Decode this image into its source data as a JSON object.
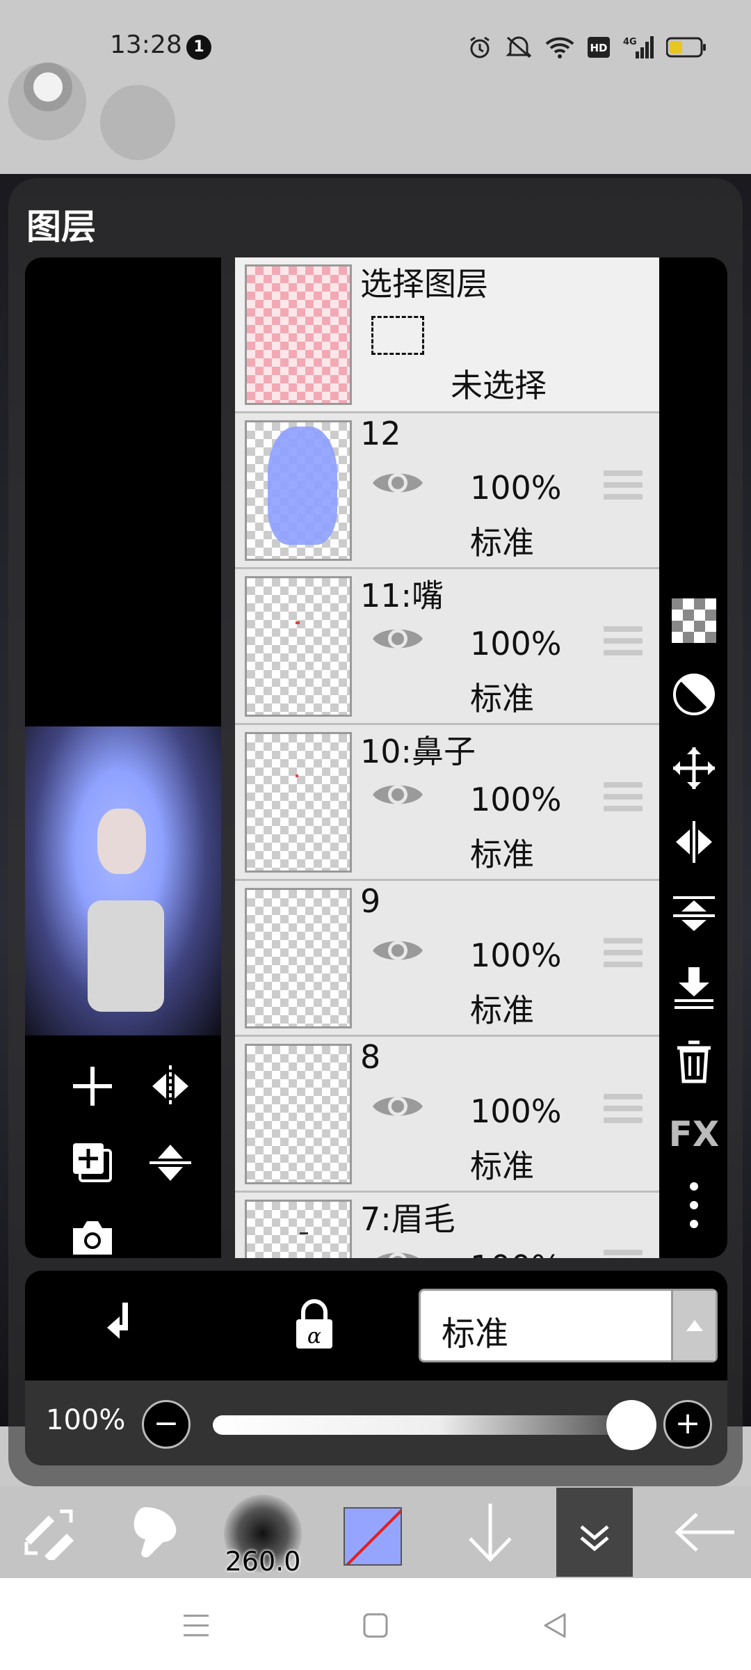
{
  "status_bar": {
    "time": "13:28",
    "notification_count": "1",
    "icons": [
      "alarm-icon",
      "mute-icon",
      "wifi-icon",
      "hd-icon",
      "signal-4g-icon",
      "battery-icon"
    ],
    "hd_label": "HD",
    "network_label": "4G"
  },
  "panel": {
    "title": "图层"
  },
  "layers": [
    {
      "name": "选择图层",
      "type": "selection",
      "status": "未选择"
    },
    {
      "name": "12",
      "opacity": "100%",
      "mode": "标准",
      "thumb": "hair"
    },
    {
      "name": "11:嘴",
      "opacity": "100%",
      "mode": "标准",
      "thumb": "mouth"
    },
    {
      "name": "10:鼻子",
      "opacity": "100%",
      "mode": "标准",
      "thumb": "nose"
    },
    {
      "name": "9",
      "opacity": "100%",
      "mode": "标准",
      "thumb": "empty"
    },
    {
      "name": "8",
      "opacity": "100%",
      "mode": "标准",
      "thumb": "empty"
    },
    {
      "name": "7:眉毛",
      "opacity": "100%",
      "mode": "标准",
      "thumb": "brow"
    }
  ],
  "side_toolbar": [
    "transparency-grid-icon",
    "invert-icon",
    "move-icon",
    "flip-horizontal-icon",
    "flip-vertical-icon",
    "merge-down-icon",
    "trash-icon",
    "fx-icon",
    "more-vertical-icon"
  ],
  "side_fx_label": "FX",
  "preview_tools": [
    "add-layer-icon",
    "flip-horizontal-icon",
    "duplicate-layer-icon",
    "flip-vertical-icon",
    "camera-icon"
  ],
  "blend": {
    "mode": "标准"
  },
  "opacity": {
    "label": "100%",
    "value_percent": 100,
    "minus": "−",
    "plus": "+"
  },
  "bottom_toolbar": {
    "brush_size": "260.0",
    "brush_color": "#95a5ff",
    "items": [
      "tool-swap-icon",
      "finger-tool-icon",
      "brush-size",
      "color-swatch",
      "arrow-down-icon",
      "collapse-icon",
      "back-arrow-icon"
    ]
  },
  "navbar": [
    "menu-icon",
    "home-icon",
    "back-icon"
  ]
}
